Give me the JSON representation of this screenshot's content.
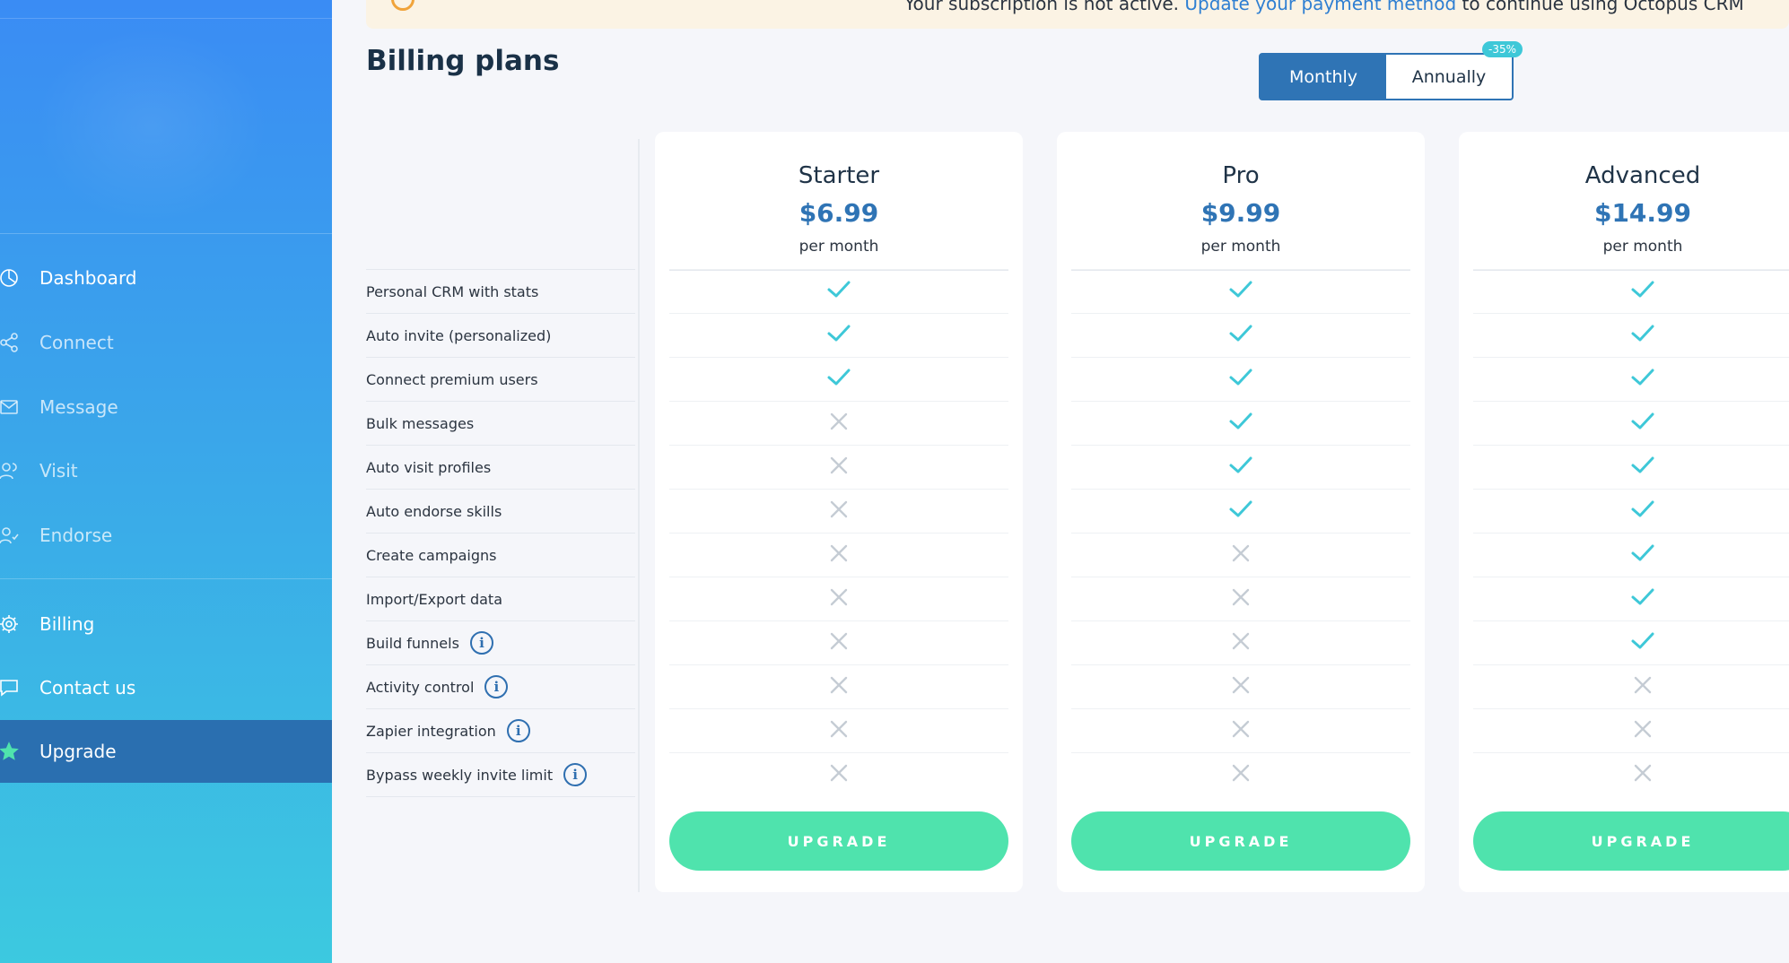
{
  "banner": {
    "text_before": "Your subscription is not active.",
    "link": "Update your payment method",
    "text_after": "to continue using Octopus CRM"
  },
  "sidebar": {
    "items": [
      {
        "label": "Dashboard",
        "icon": "pie-chart-icon"
      },
      {
        "label": "Connect",
        "icon": "share-icon"
      },
      {
        "label": "Message",
        "icon": "envelope-icon"
      },
      {
        "label": "Visit",
        "icon": "users-icon"
      },
      {
        "label": "Endorse",
        "icon": "user-check-icon"
      },
      {
        "label": "Billing",
        "icon": "gear-icon"
      },
      {
        "label": "Contact us",
        "icon": "chat-bubble-icon"
      },
      {
        "label": "Upgrade",
        "icon": "star-icon",
        "active": true
      }
    ]
  },
  "page": {
    "title": "Billing plans"
  },
  "toggle": {
    "monthly": "Monthly",
    "annually": "Annually",
    "discount_badge": "-35%",
    "selected": "Monthly"
  },
  "features": [
    {
      "label": "Personal CRM with stats",
      "info": false
    },
    {
      "label": "Auto invite (personalized)",
      "info": false
    },
    {
      "label": "Connect premium users",
      "info": false
    },
    {
      "label": "Bulk messages",
      "info": false
    },
    {
      "label": "Auto visit profiles",
      "info": false
    },
    {
      "label": "Auto endorse skills",
      "info": false
    },
    {
      "label": "Create campaigns",
      "info": false
    },
    {
      "label": "Import/Export data",
      "info": false
    },
    {
      "label": "Build funnels",
      "info": true
    },
    {
      "label": "Activity control",
      "info": true
    },
    {
      "label": "Zapier integration",
      "info": true
    },
    {
      "label": "Bypass weekly invite limit",
      "info": true
    }
  ],
  "plans": [
    {
      "name": "Starter",
      "price": "$6.99",
      "period": "per month",
      "button": "UPGRADE",
      "included": [
        true,
        true,
        true,
        false,
        false,
        false,
        false,
        false,
        false,
        false,
        false,
        false
      ]
    },
    {
      "name": "Pro",
      "price": "$9.99",
      "period": "per month",
      "button": "UPGRADE",
      "included": [
        true,
        true,
        true,
        true,
        true,
        true,
        false,
        false,
        false,
        false,
        false,
        false
      ]
    },
    {
      "name": "Advanced",
      "price": "$14.99",
      "period": "per month",
      "button": "UPGRADE",
      "included": [
        true,
        true,
        true,
        true,
        true,
        true,
        true,
        true,
        true,
        false,
        false,
        false
      ]
    }
  ],
  "colors": {
    "accent": "#2f74b5",
    "check": "#3ec8d8",
    "cross": "#c5ccd4",
    "button": "#4fe3ad"
  }
}
